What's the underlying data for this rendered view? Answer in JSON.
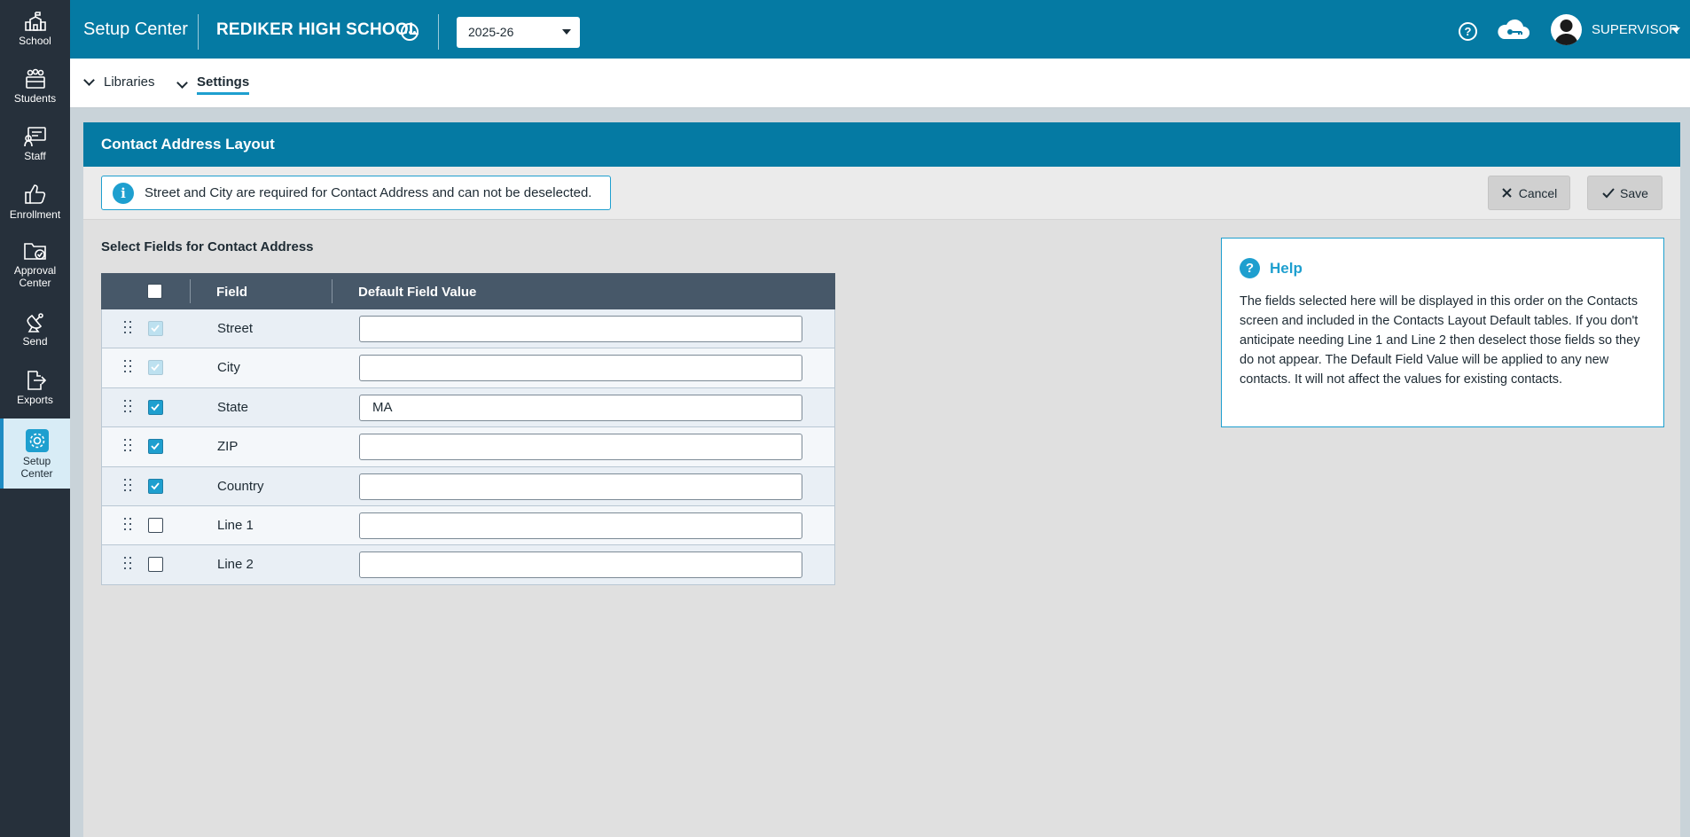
{
  "sidebar": {
    "items": [
      {
        "label": "School",
        "icon": "school-icon"
      },
      {
        "label": "Students",
        "icon": "students-icon"
      },
      {
        "label": "Staff",
        "icon": "staff-icon"
      },
      {
        "label": "Enrollment",
        "icon": "thumbs-up-icon"
      },
      {
        "label": "Approval Center",
        "icon": "folder-check-icon"
      },
      {
        "label": "Send",
        "icon": "satellite-icon"
      },
      {
        "label": "Exports",
        "icon": "export-icon"
      },
      {
        "label": "Setup Center",
        "icon": "gear-icon"
      }
    ]
  },
  "topbar": {
    "app_title": "Setup Center",
    "school_name": "REDIKER HIGH SCHOOL",
    "year": "2025-26",
    "help_glyph": "?",
    "user": "SUPERVISOR"
  },
  "subnav": {
    "libraries": "Libraries",
    "settings": "Settings"
  },
  "panel": {
    "title": "Contact Address Layout",
    "info_message": "Street and City are required for Contact Address and can not be deselected.",
    "cancel_label": "Cancel",
    "save_label": "Save",
    "section_label": "Select Fields for Contact Address"
  },
  "table": {
    "col_field": "Field",
    "col_default": "Default Field Value",
    "rows": [
      {
        "field": "Street",
        "checked": true,
        "disabled": true,
        "value": ""
      },
      {
        "field": "City",
        "checked": true,
        "disabled": true,
        "value": ""
      },
      {
        "field": "State",
        "checked": true,
        "disabled": false,
        "value": "MA"
      },
      {
        "field": "ZIP",
        "checked": true,
        "disabled": false,
        "value": ""
      },
      {
        "field": "Country",
        "checked": true,
        "disabled": false,
        "value": ""
      },
      {
        "field": "Line 1",
        "checked": false,
        "disabled": false,
        "value": ""
      },
      {
        "field": "Line 2",
        "checked": false,
        "disabled": false,
        "value": ""
      }
    ]
  },
  "help": {
    "title": "Help",
    "glyph": "?",
    "text": "The fields selected here will be displayed in this order on the Contacts screen and included in the Contacts Layout Default tables. If you don't anticipate needing Line 1 and Line 2 then deselect those fields so they do not appear. The Default Field Value will be applied to any new contacts. It will not affect the values for existing contacts."
  },
  "colors": {
    "topbar": "#057aa3",
    "sidebar": "#26303b",
    "accent": "#1e9fcf",
    "table_header": "#475869"
  }
}
